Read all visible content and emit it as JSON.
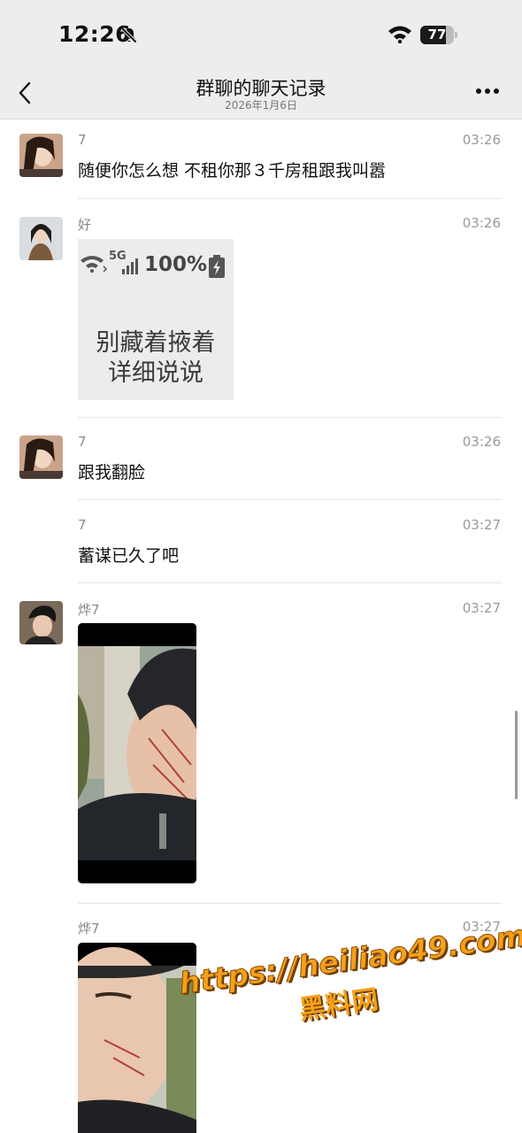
{
  "status_bar": {
    "time": "12:26",
    "battery": "77",
    "battery_level": 0.77
  },
  "header": {
    "title": "群聊的聊天记录",
    "subtitle": "2026年1月6日"
  },
  "messages": [
    {
      "sender": "7",
      "time": "03:26",
      "text": "随便你怎么想 不租你那３千房租跟我叫嚣"
    },
    {
      "sender": "好",
      "time": "03:26",
      "sticker": {
        "status_5g": "5G",
        "status_percent": "100%",
        "line1": "别藏着掖着",
        "line2": "详细说说"
      }
    },
    {
      "sender": "7",
      "time": "03:26",
      "text": "跟我翻脸"
    },
    {
      "sender": "7",
      "time": "03:27",
      "text": "蓄谋已久了吧"
    },
    {
      "sender": "烨7",
      "time": "03:27"
    },
    {
      "sender": "烨7",
      "time": "03:27"
    }
  ],
  "watermark": {
    "url": "https://heiliao49.com",
    "name": "黑料网"
  },
  "colors": {
    "background": "#ffffff",
    "bar": "#ededed",
    "watermark": "#f4a11a"
  }
}
